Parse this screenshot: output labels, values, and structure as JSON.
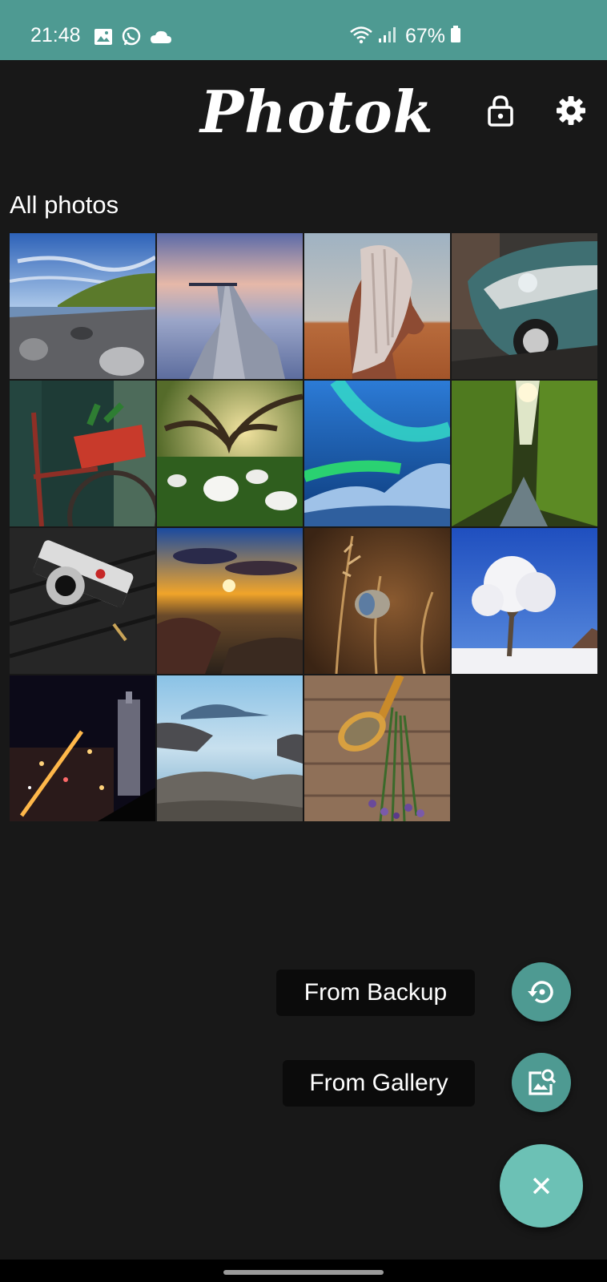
{
  "status_bar": {
    "time": "21:48",
    "battery_text": "67%",
    "icons": [
      "image-icon",
      "whatsapp-icon",
      "cloud-icon",
      "wifi-icon",
      "signal-icon",
      "battery-icon"
    ]
  },
  "app": {
    "logo_text": "Photok",
    "icons": [
      "lock-icon",
      "gear-icon"
    ]
  },
  "main": {
    "section_title": "All photos",
    "photos": [
      {
        "subject": "rocky coast"
      },
      {
        "subject": "wooden pier"
      },
      {
        "subject": "horse"
      },
      {
        "subject": "vintage car"
      },
      {
        "subject": "red bicycle"
      },
      {
        "subject": "calla lilies under tree"
      },
      {
        "subject": "aurora"
      },
      {
        "subject": "mossy gorge"
      },
      {
        "subject": "camera"
      },
      {
        "subject": "sunset sea"
      },
      {
        "subject": "butterfly on grass"
      },
      {
        "subject": "frosted tree"
      },
      {
        "subject": "city at night"
      },
      {
        "subject": "misty rocky shore"
      },
      {
        "subject": "lavender and spoon"
      }
    ]
  },
  "fab_menu": {
    "backup_label": "From Backup",
    "gallery_label": "From Gallery",
    "icons": [
      "restore-icon",
      "image-search-icon",
      "close-icon"
    ]
  },
  "colors": {
    "teal": "#4e9a92",
    "teal_light": "#6cc1b5",
    "background": "#181818",
    "label_bg": "#0b0b0b"
  }
}
